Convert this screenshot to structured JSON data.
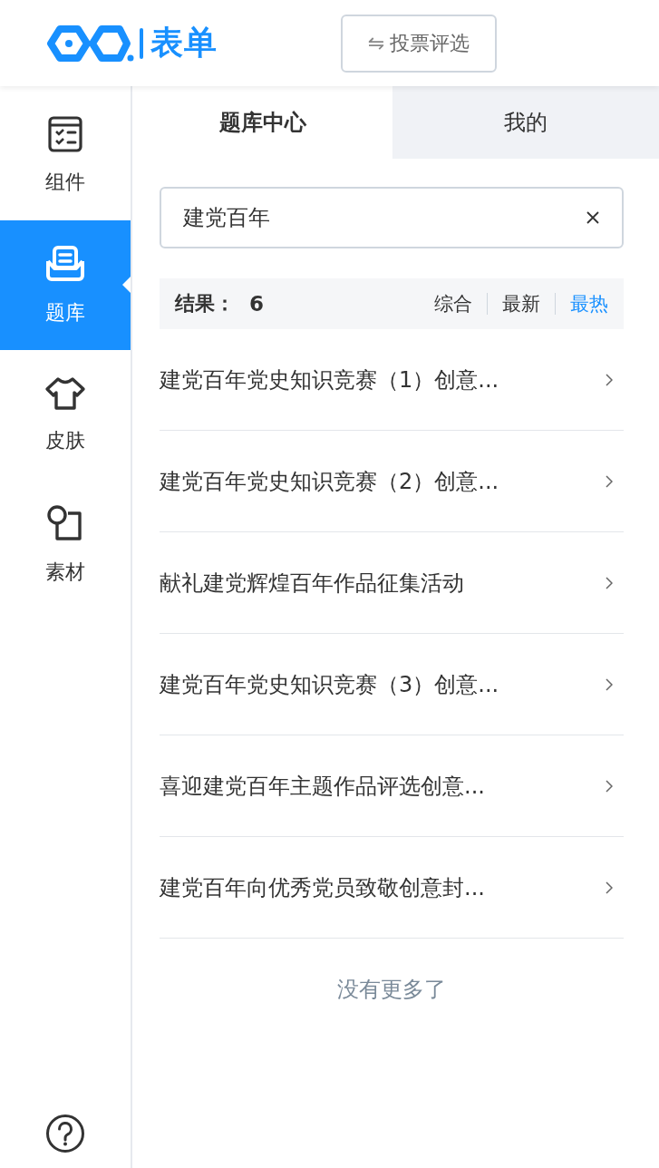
{
  "header": {
    "logo_text": "表单",
    "action_button": {
      "icon": "⇋",
      "label": "投票评选"
    }
  },
  "sidebar": {
    "items": [
      {
        "kind": "components",
        "label": "组件",
        "selected": false
      },
      {
        "kind": "library",
        "label": "题库",
        "selected": true
      },
      {
        "kind": "skin",
        "label": "皮肤",
        "selected": false
      },
      {
        "kind": "material",
        "label": "素材",
        "selected": false
      }
    ]
  },
  "tabs": [
    {
      "label": "题库中心",
      "selected": true
    },
    {
      "label": "我的",
      "selected": false
    }
  ],
  "search": {
    "value": "建党百年"
  },
  "results": {
    "label": "结果：",
    "count": "6",
    "sorts": [
      {
        "label": "综合",
        "selected": false
      },
      {
        "label": "最新",
        "selected": false
      },
      {
        "label": "最热",
        "selected": true
      }
    ]
  },
  "list": [
    {
      "title": "建党百年党史知识竞赛（1）创意..."
    },
    {
      "title": "建党百年党史知识竞赛（2）创意..."
    },
    {
      "title": "献礼建党辉煌百年作品征集活动"
    },
    {
      "title": "建党百年党史知识竞赛（3）创意..."
    },
    {
      "title": "喜迎建党百年主题作品评选创意..."
    },
    {
      "title": "建党百年向优秀党员致敬创意封..."
    }
  ],
  "footer_note": "没有更多了"
}
